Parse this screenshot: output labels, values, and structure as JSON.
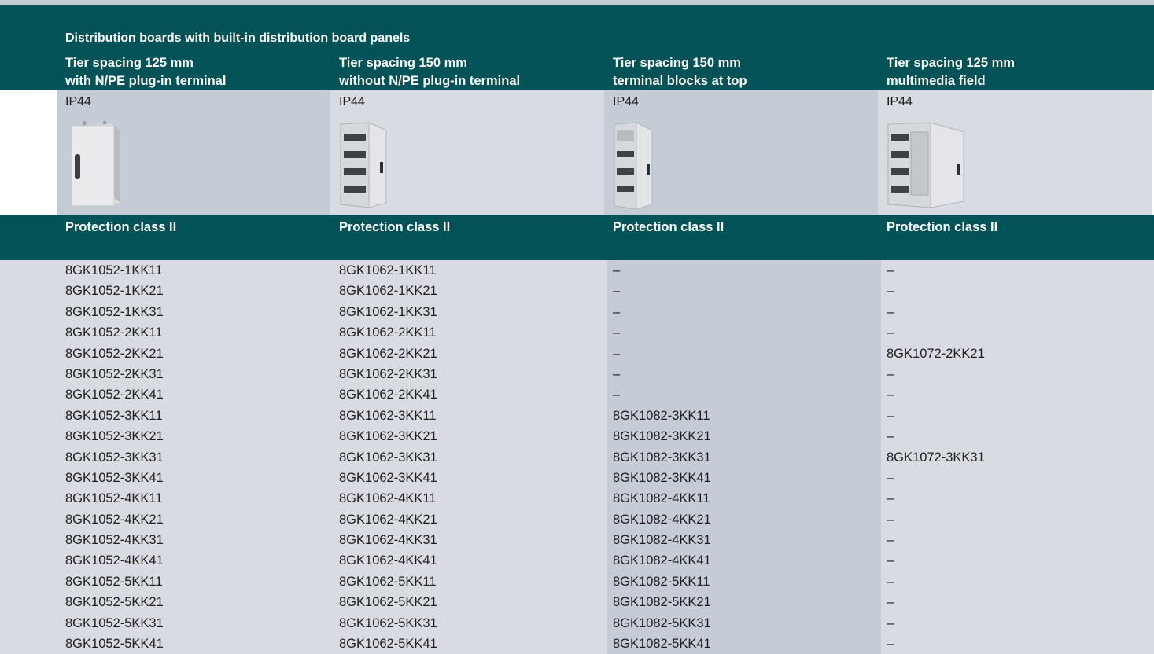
{
  "title": "Distribution boards with built-in distribution board panels",
  "columns": [
    {
      "line1": "Tier spacing 125 mm",
      "line2": "with N/PE plug-in terminal",
      "ip": "IP44",
      "protection": "Protection class II",
      "image_icon": "closed-cabinet-icon"
    },
    {
      "line1": "Tier spacing 150 mm",
      "line2": "without N/PE plug-in terminal",
      "ip": "IP44",
      "protection": "Protection class II",
      "image_icon": "open-cabinet-icon"
    },
    {
      "line1": "Tier spacing 150 mm",
      "line2": "terminal blocks at top",
      "ip": "IP44",
      "protection": "Protection class II",
      "image_icon": "narrow-cabinet-icon"
    },
    {
      "line1": "Tier spacing 125 mm",
      "line2": "multimedia field",
      "ip": "IP44",
      "protection": "Protection class II",
      "image_icon": "multimedia-cabinet-icon"
    }
  ],
  "rows": [
    {
      "c": [
        "8GK1052-1KK11",
        "8GK1062-1KK11",
        "–",
        "–"
      ]
    },
    {
      "c": [
        "8GK1052-1KK21",
        "8GK1062-1KK21",
        "–",
        "–"
      ]
    },
    {
      "c": [
        "8GK1052-1KK31",
        "8GK1062-1KK31",
        "–",
        "–"
      ],
      "major": true
    },
    {
      "c": [
        "8GK1052-2KK11",
        "8GK1062-2KK11",
        "–",
        "–"
      ]
    },
    {
      "c": [
        "8GK1052-2KK21",
        "8GK1062-2KK21",
        "–",
        "8GK1072-2KK21"
      ]
    },
    {
      "c": [
        "8GK1052-2KK31",
        "8GK1062-2KK31",
        "–",
        "–"
      ]
    },
    {
      "c": [
        "8GK1052-2KK41",
        "8GK1062-2KK41",
        "–",
        "–"
      ],
      "major": true
    },
    {
      "c": [
        "8GK1052-3KK11",
        "8GK1062-3KK11",
        "8GK1082-3KK11",
        "–"
      ]
    },
    {
      "c": [
        "8GK1052-3KK21",
        "8GK1062-3KK21",
        "8GK1082-3KK21",
        "–"
      ]
    },
    {
      "c": [
        "8GK1052-3KK31",
        "8GK1062-3KK31",
        "8GK1082-3KK31",
        "8GK1072-3KK31"
      ]
    },
    {
      "c": [
        "8GK1052-3KK41",
        "8GK1062-3KK41",
        "8GK1082-3KK41",
        "–"
      ],
      "major": true
    },
    {
      "c": [
        "8GK1052-4KK11",
        "8GK1062-4KK11",
        "8GK1082-4KK11",
        "–"
      ]
    },
    {
      "c": [
        "8GK1052-4KK21",
        "8GK1062-4KK21",
        "8GK1082-4KK21",
        "–"
      ]
    },
    {
      "c": [
        "8GK1052-4KK31",
        "8GK1062-4KK31",
        "8GK1082-4KK31",
        "–"
      ]
    },
    {
      "c": [
        "8GK1052-4KK41",
        "8GK1062-4KK41",
        "8GK1082-4KK41",
        "–"
      ],
      "major": true
    },
    {
      "c": [
        "8GK1052-5KK11",
        "8GK1062-5KK11",
        "8GK1082-5KK11",
        "–"
      ]
    },
    {
      "c": [
        "8GK1052-5KK21",
        "8GK1062-5KK21",
        "8GK1082-5KK21",
        "–"
      ]
    },
    {
      "c": [
        "8GK1052-5KK31",
        "8GK1062-5KK31",
        "8GK1082-5KK31",
        "–"
      ]
    },
    {
      "c": [
        "8GK1052-5KK41",
        "8GK1062-5KK41",
        "8GK1082-5KK41",
        "–"
      ]
    }
  ],
  "colors": {
    "header": "#015357",
    "light_cell": "#d8dbe1",
    "dark_cell": "#c6ccd6"
  }
}
